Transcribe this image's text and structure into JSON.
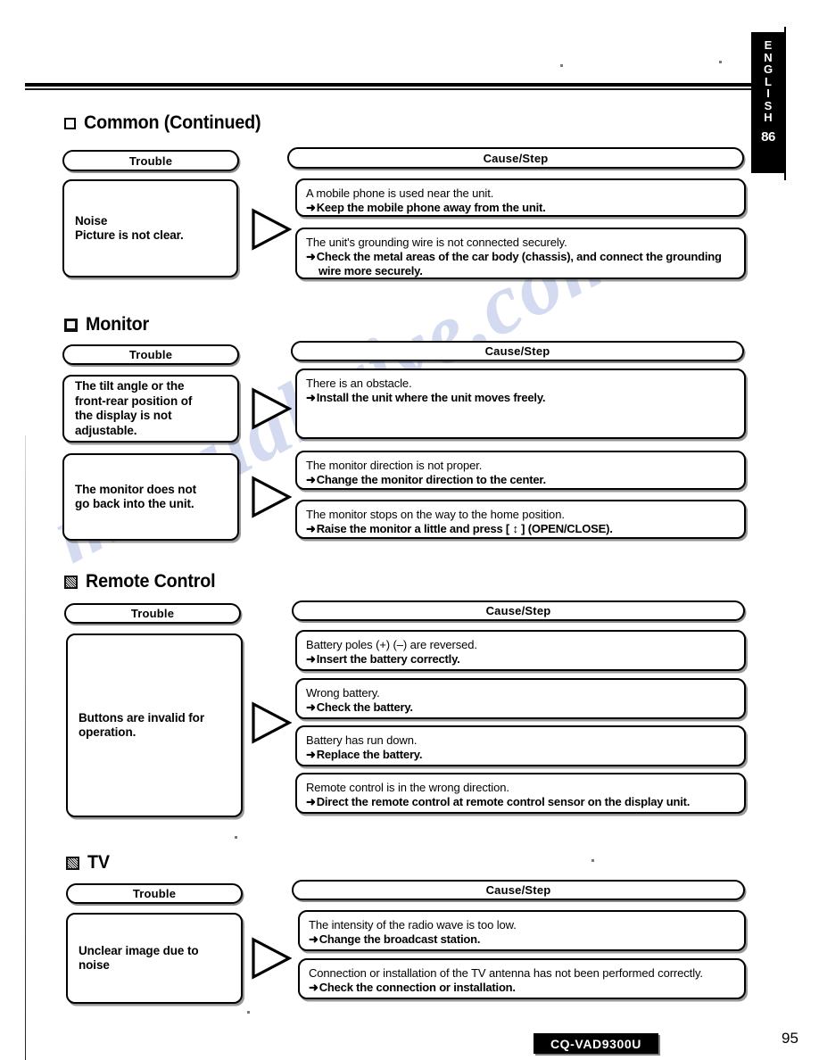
{
  "document": {
    "model_badge": "CQ-VAD9300U",
    "page_number": "95",
    "side_tab": {
      "language": "ENGLISH",
      "letters": [
        "E",
        "N",
        "G",
        "L",
        "I",
        "S",
        "H"
      ],
      "reference_page": "86"
    },
    "watermark": "manualsrive.com"
  },
  "column_headers": {
    "trouble": "Trouble",
    "cause_step": "Cause/Step"
  },
  "sections": [
    {
      "id": "common",
      "title": "Common (Continued)",
      "icon": "checkbox-outline-icon",
      "rows": [
        {
          "trouble": "Noise\nPicture is not clear.",
          "causes": [
            {
              "cause": "A mobile phone is used near the unit.",
              "step": "Keep the mobile phone away from the unit."
            },
            {
              "cause": "The unit's grounding wire is not connected securely.",
              "step": "Check the metal areas of the car body (chassis), and connect the grounding wire more securely."
            }
          ]
        }
      ]
    },
    {
      "id": "monitor",
      "title": "Monitor",
      "icon": "monitor-icon",
      "rows": [
        {
          "trouble": "The tilt angle or the\nfront-rear position of\nthe display is not\nadjustable.",
          "causes": [
            {
              "cause": "There is an obstacle.",
              "step": "Install the unit where the unit moves freely."
            }
          ]
        },
        {
          "trouble": "The monitor does not\ngo back into the unit.",
          "causes": [
            {
              "cause": "The monitor direction is not proper.",
              "step": "Change the monitor direction to the center."
            },
            {
              "cause": "The monitor stops on the way to the home position.",
              "step": "Raise the monitor a little and press [ ↕ ] (OPEN/CLOSE)."
            }
          ]
        }
      ]
    },
    {
      "id": "remote-control",
      "title": "Remote Control",
      "icon": "remote-control-icon",
      "rows": [
        {
          "trouble": "Buttons are invalid for\noperation.",
          "causes": [
            {
              "cause": "Battery poles (+) (–) are reversed.",
              "step": "Insert the battery correctly."
            },
            {
              "cause": "Wrong battery.",
              "step": "Check the battery."
            },
            {
              "cause": "Battery has run down.",
              "step": "Replace the battery."
            },
            {
              "cause": "Remote control is in the wrong direction.",
              "step": "Direct the remote control at remote control sensor on the display unit."
            }
          ]
        }
      ]
    },
    {
      "id": "tv",
      "title": "TV",
      "icon": "tv-icon",
      "rows": [
        {
          "trouble": "Unclear image due to\nnoise",
          "causes": [
            {
              "cause": "The intensity of the radio wave is too low.",
              "step": "Change the broadcast station."
            },
            {
              "cause": "Connection or installation of the TV antenna has not been performed correctly.",
              "step": "Check the connection or installation."
            }
          ]
        }
      ]
    }
  ],
  "arrow_glyph": "➜"
}
